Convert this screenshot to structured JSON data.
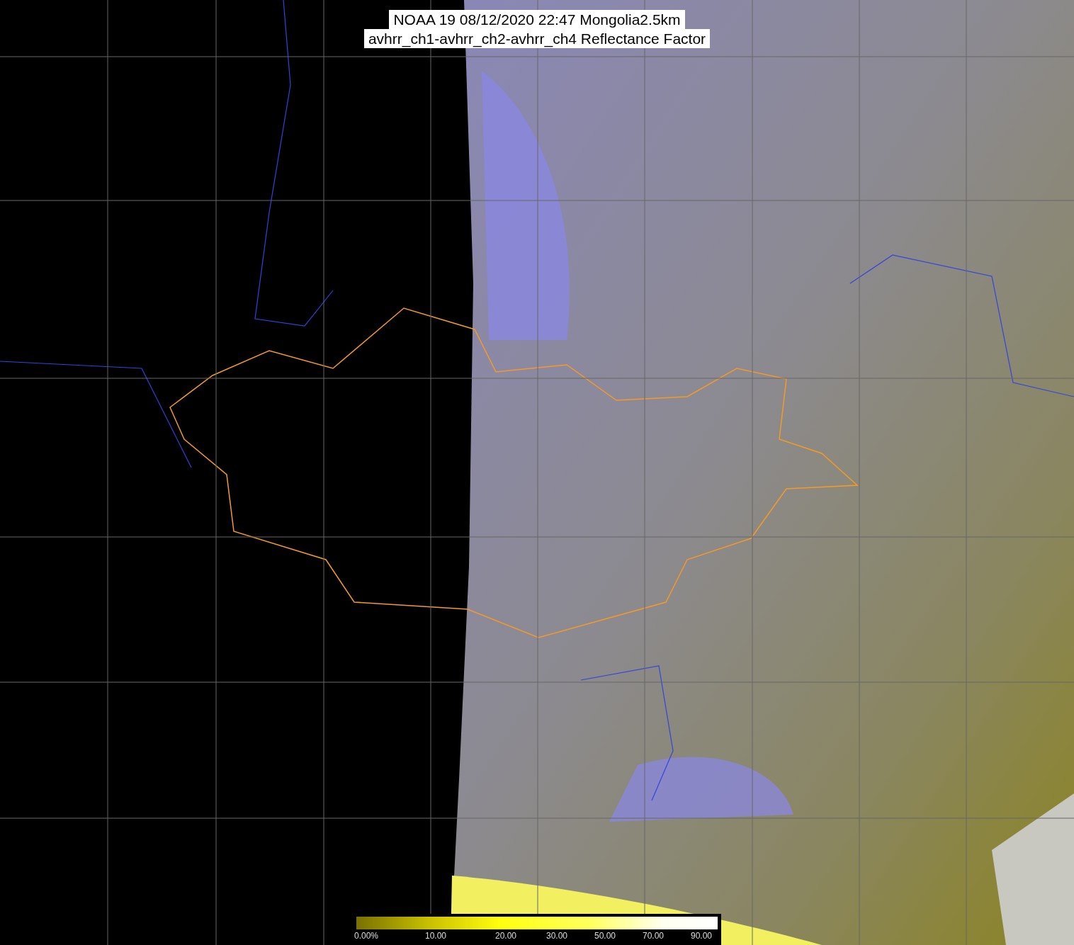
{
  "title": {
    "line_1": "NOAA 19 08/12/2020 22:47 Mongolia2.5km",
    "line_2": "avhrr_ch1-avhrr_ch2-avhrr_ch4 Reflectance Factor"
  },
  "colorbar": {
    "labels": [
      "0.00%",
      "10.00",
      "20.00",
      "30.00",
      "50.00",
      "70.00",
      "90.00"
    ]
  }
}
